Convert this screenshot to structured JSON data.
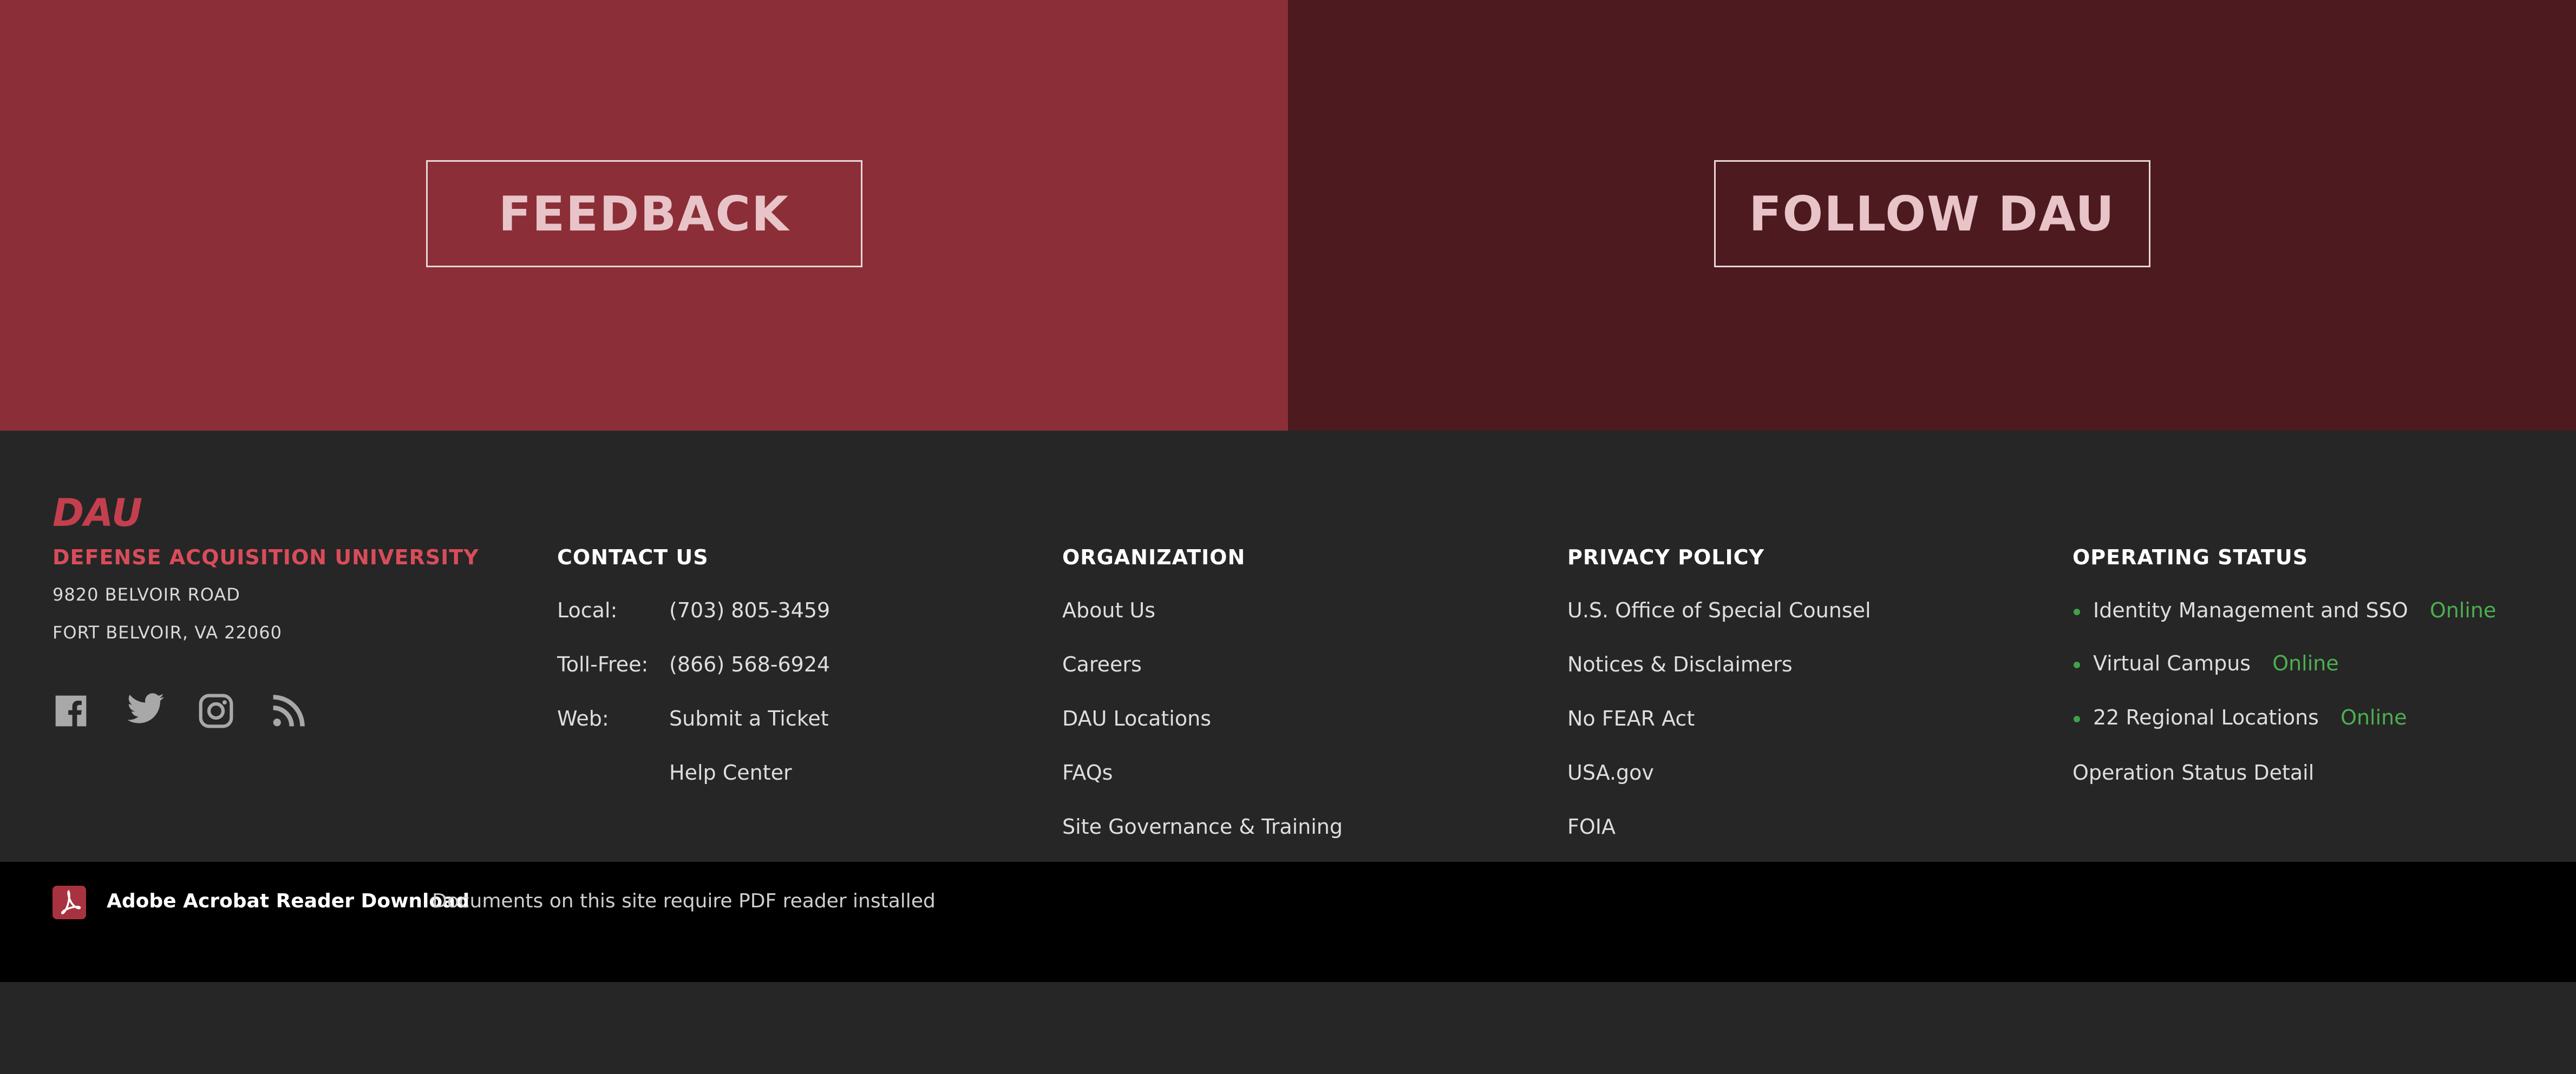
{
  "hero": {
    "feedback_label": "FEEDBACK",
    "follow_label": "FOLLOW DAU",
    "left_color": "#8b2e37",
    "right_color": "#4c1a1f"
  },
  "brand": {
    "logo_text": "DAU",
    "name": "DEFENSE ACQUISITION UNIVERSITY",
    "address_line1": "9820 BELVOIR ROAD",
    "address_line2": "FORT BELVOIR, VA 22060",
    "accent_color": "#d94c5a"
  },
  "social": {
    "icons": [
      "facebook-icon",
      "twitter-icon",
      "instagram-icon",
      "rss-icon"
    ]
  },
  "contact": {
    "title": "CONTACT US",
    "local_label": "Local:",
    "local_value": "(703) 805-3459",
    "tollfree_label": "Toll-Free:",
    "tollfree_value": "(866) 568-6924",
    "web_label": "Web:",
    "web_link1": "Submit a Ticket",
    "web_link2": "Help Center"
  },
  "organization": {
    "title": "ORGANIZATION",
    "items": [
      "About Us",
      "Careers",
      "DAU Locations",
      "FAQs",
      "Site Governance & Training"
    ]
  },
  "privacy": {
    "title": "PRIVACY POLICY",
    "items": [
      "U.S. Office of Special Counsel",
      "Notices & Disclaimers",
      "No FEAR Act",
      "USA.gov",
      "FOIA"
    ]
  },
  "status": {
    "title": "OPERATING STATUS",
    "items": [
      {
        "label": "Identity Management and SSO",
        "state": "Online"
      },
      {
        "label": "Virtual Campus",
        "state": "Online"
      },
      {
        "label": "22 Regional Locations",
        "state": "Online"
      }
    ],
    "detail_link": "Operation Status Detail",
    "online_color": "#4caf50"
  },
  "bottom_bar": {
    "pdf_title": "Adobe Acrobat Reader Download",
    "pdf_note": "Documents on this site require PDF reader installed"
  }
}
